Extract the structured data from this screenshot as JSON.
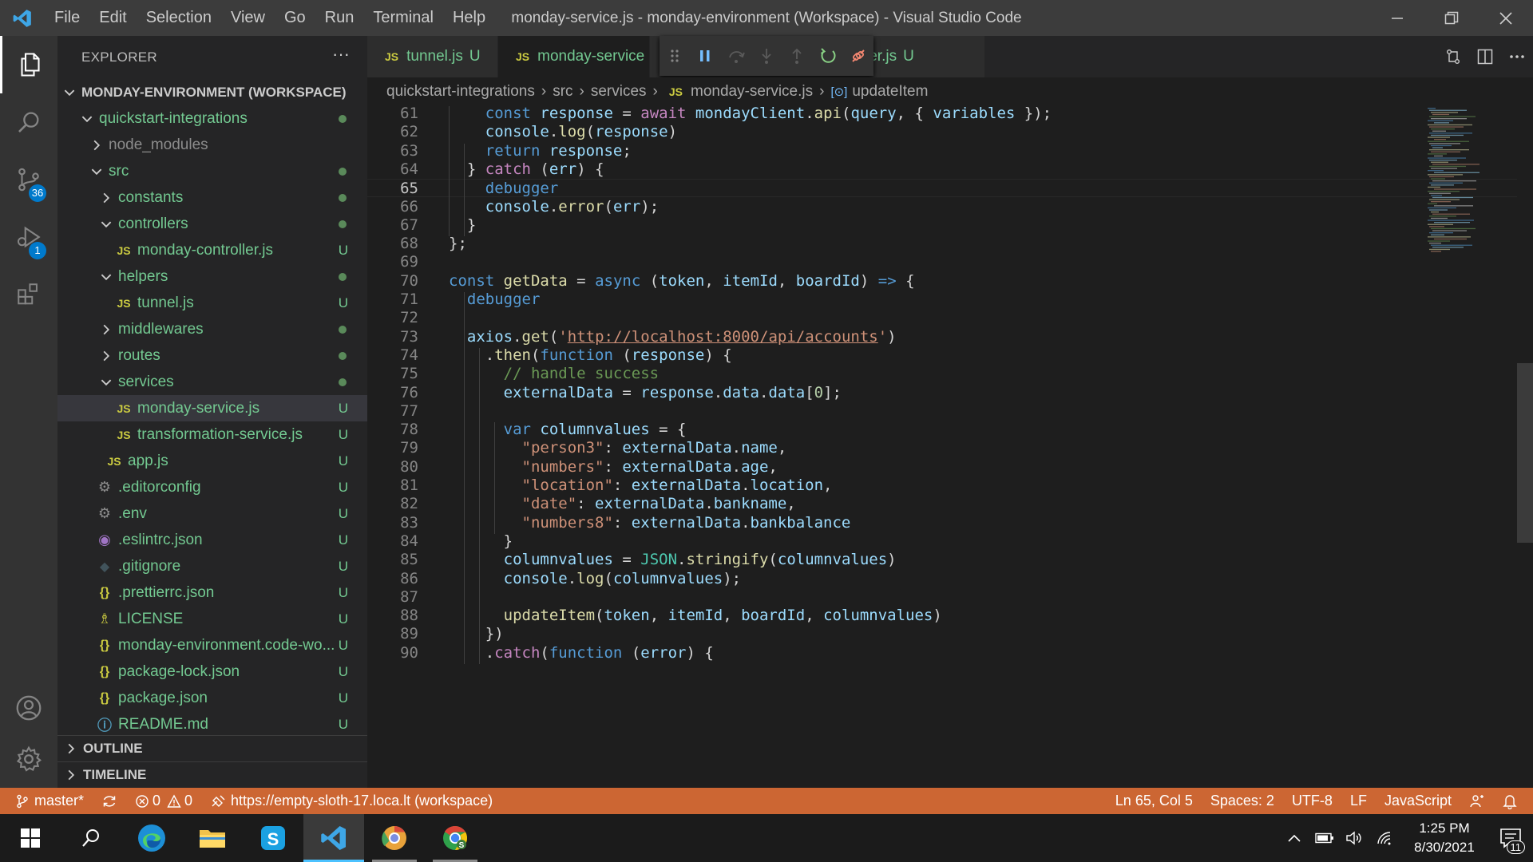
{
  "titlebar": {
    "menu": [
      "File",
      "Edit",
      "Selection",
      "View",
      "Go",
      "Run",
      "Terminal",
      "Help"
    ],
    "title": "monday-service.js - monday-environment (Workspace) - Visual Studio Code"
  },
  "activity": {
    "scm_badge": "36",
    "debug_badge": "1"
  },
  "sidebar": {
    "header": "EXPLORER",
    "more": "···",
    "workspace": "MONDAY-ENVIRONMENT (WORKSPACE)",
    "tree": [
      {
        "label": "quickstart-integrations",
        "type": "folder-open",
        "status": "dot"
      },
      {
        "label": "node_modules",
        "type": "folder-closed",
        "status": ""
      },
      {
        "label": "src",
        "type": "folder-open",
        "status": "dot"
      },
      {
        "label": "constants",
        "type": "folder-closed",
        "status": "dot"
      },
      {
        "label": "controllers",
        "type": "folder-open",
        "status": "dot"
      },
      {
        "label": "monday-controller.js",
        "type": "js",
        "status": "U"
      },
      {
        "label": "helpers",
        "type": "folder-open",
        "status": "dot"
      },
      {
        "label": "tunnel.js",
        "type": "js",
        "status": "U"
      },
      {
        "label": "middlewares",
        "type": "folder-closed",
        "status": "dot"
      },
      {
        "label": "routes",
        "type": "folder-closed",
        "status": "dot"
      },
      {
        "label": "services",
        "type": "folder-open",
        "status": "dot"
      },
      {
        "label": "monday-service.js",
        "type": "js",
        "status": "U"
      },
      {
        "label": "transformation-service.js",
        "type": "js",
        "status": "U"
      },
      {
        "label": "app.js",
        "type": "js",
        "status": "U"
      },
      {
        "label": ".editorconfig",
        "type": "gear",
        "status": "U"
      },
      {
        "label": ".env",
        "type": "gear",
        "status": "U"
      },
      {
        "label": ".eslintrc.json",
        "type": "eslint",
        "status": "U"
      },
      {
        "label": ".gitignore",
        "type": "git",
        "status": "U"
      },
      {
        "label": ".prettierrc.json",
        "type": "json",
        "status": "U"
      },
      {
        "label": "LICENSE",
        "type": "license",
        "status": "U"
      },
      {
        "label": "monday-environment.code-wo...",
        "type": "json",
        "status": "U"
      },
      {
        "label": "package-lock.json",
        "type": "json",
        "status": "U"
      },
      {
        "label": "package.json",
        "type": "json",
        "status": "U"
      },
      {
        "label": "README.md",
        "type": "info",
        "status": "U"
      }
    ],
    "outline": "OUTLINE",
    "timeline": "TIMELINE"
  },
  "tabs": [
    {
      "icon": "JS",
      "name": "tunnel.js",
      "mark": "U"
    },
    {
      "icon": "JS",
      "name": "monday-service",
      "mark": ""
    },
    {
      "icon": "",
      "name": "ler.js",
      "mark": "U"
    }
  ],
  "breadcrumb": {
    "parts": [
      "quickstart-integrations",
      "src",
      "services"
    ],
    "file_icon": "JS",
    "file": "monday-service.js",
    "symbol_icon": "[⊙]",
    "symbol": "updateItem"
  },
  "code": {
    "current_line": "65",
    "lines": [
      {
        "n": "61",
        "text": "    const response = await mondayClient.api(query, { variables });"
      },
      {
        "n": "62",
        "text": "    console.log(response)"
      },
      {
        "n": "63",
        "text": "    return response;"
      },
      {
        "n": "64",
        "text": "  } catch (err) {"
      },
      {
        "n": "65",
        "text": "    debugger"
      },
      {
        "n": "66",
        "text": "    console.error(err);"
      },
      {
        "n": "67",
        "text": "  }"
      },
      {
        "n": "68",
        "text": "};"
      },
      {
        "n": "69",
        "text": ""
      },
      {
        "n": "70",
        "text": "const getData = async (token, itemId, boardId) => {"
      },
      {
        "n": "71",
        "text": "  debugger"
      },
      {
        "n": "72",
        "text": ""
      },
      {
        "n": "73",
        "text": "  axios.get('http://localhost:8000/api/accounts')"
      },
      {
        "n": "74",
        "text": "    .then(function (response) {"
      },
      {
        "n": "75",
        "text": "      // handle success"
      },
      {
        "n": "76",
        "text": "      externalData = response.data.data[0];"
      },
      {
        "n": "77",
        "text": ""
      },
      {
        "n": "78",
        "text": "      var columnvalues = {"
      },
      {
        "n": "79",
        "text": "        \"person3\": externalData.name,"
      },
      {
        "n": "80",
        "text": "        \"numbers\": externalData.age,"
      },
      {
        "n": "81",
        "text": "        \"location\": externalData.location,"
      },
      {
        "n": "82",
        "text": "        \"date\": externalData.bankname,"
      },
      {
        "n": "83",
        "text": "        \"numbers8\": externalData.bankbalance"
      },
      {
        "n": "84",
        "text": "      }"
      },
      {
        "n": "85",
        "text": "      columnvalues = JSON.stringify(columnvalues)"
      },
      {
        "n": "86",
        "text": "      console.log(columnvalues);"
      },
      {
        "n": "87",
        "text": ""
      },
      {
        "n": "88",
        "text": "      updateItem(token, itemId, boardId, columnvalues)"
      },
      {
        "n": "89",
        "text": "    })"
      },
      {
        "n": "90",
        "text": "    .catch(function (error) {"
      }
    ]
  },
  "statusbar": {
    "branch": "master*",
    "errors": "0",
    "warnings": "0",
    "tunnel": "https://empty-sloth-17.loca.lt (workspace)",
    "position": "Ln 65, Col 5",
    "spaces": "Spaces: 2",
    "encoding": "UTF-8",
    "eol": "LF",
    "language": "JavaScript",
    "color": "#cc6633"
  },
  "taskbar": {
    "time": "1:25 PM",
    "date": "8/30/2021",
    "notifications": "11"
  }
}
